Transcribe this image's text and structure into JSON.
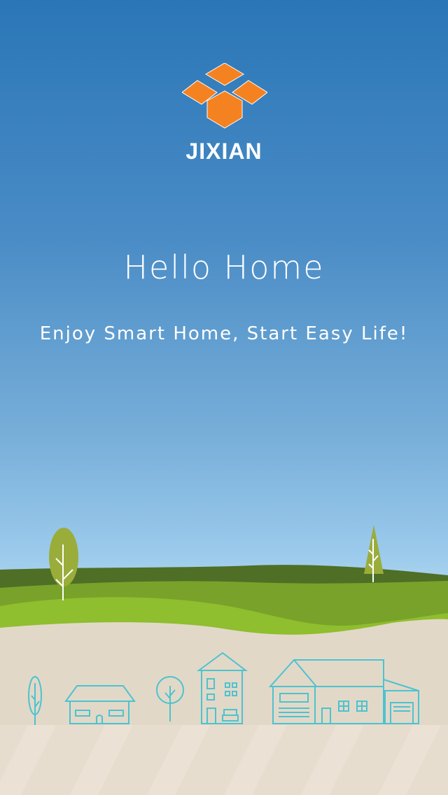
{
  "app": {
    "brand_name": "JIXIAN",
    "title": "Hello Home",
    "subtitle": "Enjoy Smart Home, Start Easy Life!"
  },
  "colors": {
    "sky_top": "#2a76b7",
    "sky_bottom": "#b4d8ef",
    "logo_orange": "#f58220",
    "hill_dark": "#4e6f25",
    "hill_mid": "#78a22a",
    "hill_light": "#8fbe2e",
    "ground": "#e2d8c8",
    "line_art": "#4cc3cf"
  },
  "icons": {
    "logo": "jixian-logo-icon",
    "scene": "landscape-houses-illustration"
  }
}
